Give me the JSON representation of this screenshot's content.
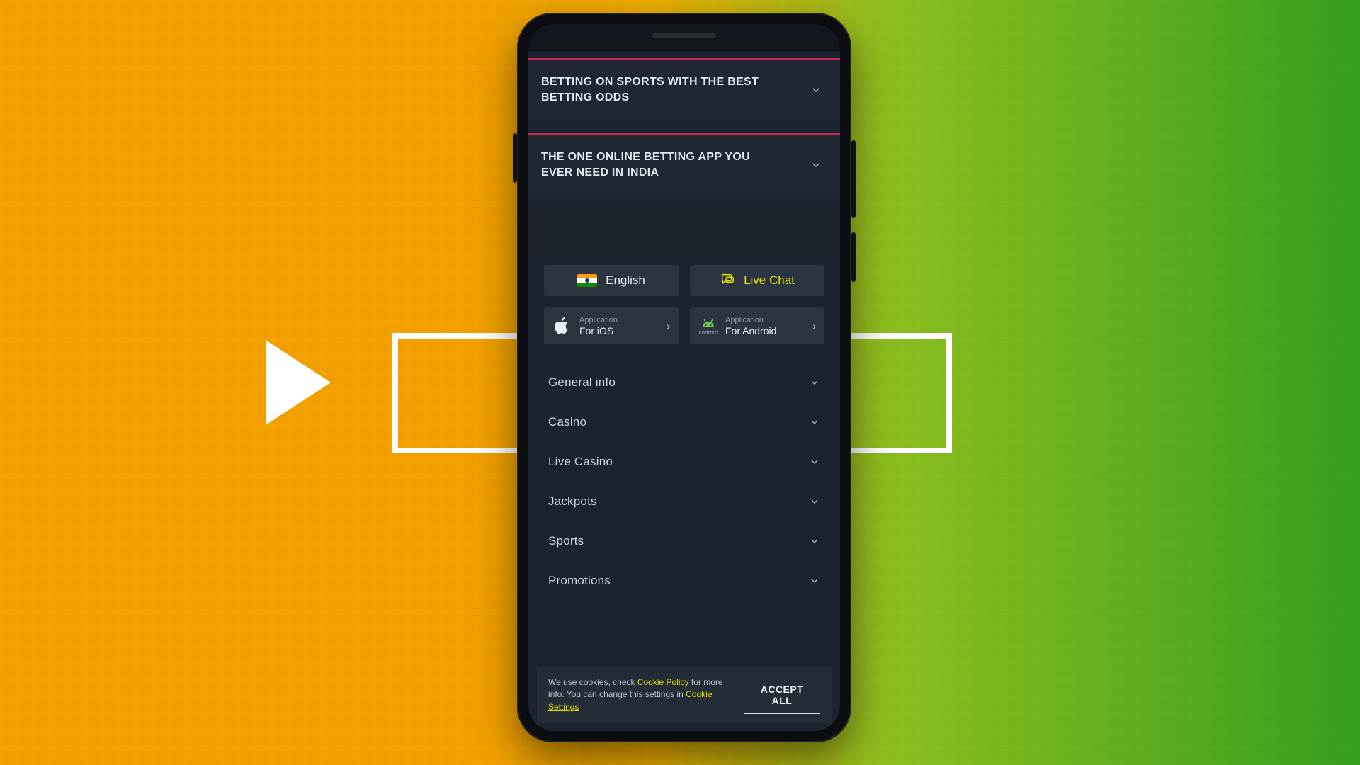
{
  "accordions": [
    {
      "title": "BETTING ON SPORTS WITH THE BEST BETTING ODDS"
    },
    {
      "title": "THE ONE ONLINE BETTING APP YOU EVER NEED IN INDIA"
    }
  ],
  "top_buttons": {
    "language_label": "English",
    "livechat_label": "Live Chat"
  },
  "app_downloads": {
    "sup_label": "Application",
    "ios_label": "For iOS",
    "android_label": "For Android",
    "android_wordmark": "android"
  },
  "footer_links": [
    {
      "label": "General info"
    },
    {
      "label": "Casino"
    },
    {
      "label": "Live Casino"
    },
    {
      "label": "Jackpots"
    },
    {
      "label": "Sports"
    },
    {
      "label": "Promotions"
    }
  ],
  "cookies": {
    "prefix": "We use cookies, check ",
    "policy_link": "Cookie Policy",
    "mid": " for more info. You can change this settings in ",
    "settings_link": "Cookie Settings",
    "accept_label": "ACCEPT ALL"
  }
}
